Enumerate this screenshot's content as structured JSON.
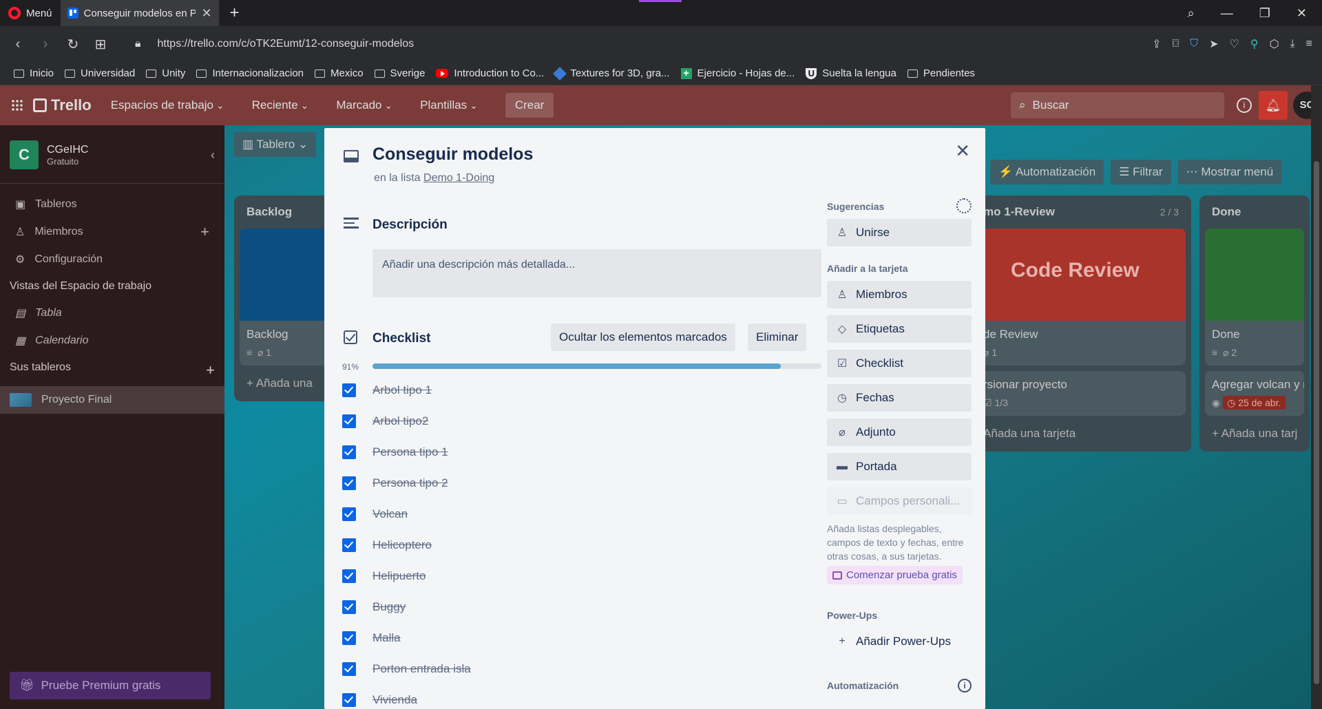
{
  "browser": {
    "menu_label": "Menú",
    "tab_title": "Conseguir modelos en Proy",
    "url": "https://trello.com/c/oTK2Eumt/12-conseguir-modelos",
    "bookmarks": [
      {
        "label": "Inicio",
        "icon": "folder-icon"
      },
      {
        "label": "Universidad",
        "icon": "folder-icon"
      },
      {
        "label": "Unity",
        "icon": "folder-icon"
      },
      {
        "label": "Internacionalizacion",
        "icon": "folder-icon"
      },
      {
        "label": "Mexico",
        "icon": "folder-icon"
      },
      {
        "label": "Sverige",
        "icon": "folder-icon"
      },
      {
        "label": "Introduction to Co...",
        "icon": "youtube-icon"
      },
      {
        "label": "Textures for 3D, gra...",
        "icon": "cube-icon"
      },
      {
        "label": "Ejercicio - Hojas de...",
        "icon": "sheets-icon"
      },
      {
        "label": "Suelta la lengua",
        "icon": "u-icon"
      },
      {
        "label": "Pendientes",
        "icon": "folder-icon"
      }
    ]
  },
  "trello": {
    "logo": "Trello",
    "nav": [
      "Espacios de trabajo",
      "Reciente",
      "Marcado",
      "Plantillas"
    ],
    "create": "Crear",
    "search_placeholder": "Buscar",
    "avatar": "SC",
    "workspace": {
      "initial": "C",
      "name": "CGeIHC",
      "plan": "Gratuito"
    },
    "sidebar_items": [
      "Tableros",
      "Miembros",
      "Configuración"
    ],
    "views_heading": "Vistas del Espacio de trabajo",
    "views": [
      "Tabla",
      "Calendario"
    ],
    "boards_heading": "Sus tableros",
    "boards": [
      "Proyecto Final"
    ],
    "premium": "Pruebe Premium gratis",
    "board_view": "Tablero",
    "automation": "Automatización",
    "filter": "Filtrar",
    "show_menu": "Mostrar menú",
    "lists": {
      "backlog": {
        "title": "Backlog",
        "card_title": "Backlog",
        "attach": "1",
        "add": "+ Añada una"
      },
      "review": {
        "title": "mo 1-Review",
        "count": "2 / 3",
        "cover_text": "Code Review",
        "card1": "de Review",
        "attach": "1",
        "card2": "rsionar proyecto",
        "check": "1/3",
        "add": "Añada una tarjeta"
      },
      "done": {
        "title": "Done",
        "card_title": "Done",
        "attach": "2",
        "card2": "Agregar volcan y m",
        "date": "25 de abr.",
        "add": "+ Añada una tarj"
      }
    }
  },
  "card": {
    "title": "Conseguir modelos",
    "in_list_prefix": "en la lista",
    "list_name": "Demo 1-Doing",
    "description_heading": "Descripción",
    "description_placeholder": "Añadir una descripción más detallada...",
    "checklist_heading": "Checklist",
    "hide_checked": "Ocultar los elementos marcados",
    "delete": "Eliminar",
    "progress_label": "91%",
    "progress_value": 0.91,
    "items": [
      "Arbol tipo 1",
      "Arbol tipo2",
      "Persona tipo 1",
      "Persona tipo 2",
      "Volcan",
      "Helicoptero",
      "Helipuerto",
      "Buggy",
      "Malla",
      "Porton entrada isla",
      "Vivienda"
    ]
  },
  "sidebar_actions": {
    "suggestions_heading": "Sugerencias",
    "join": "Unirse",
    "add_heading": "Añadir a la tarjeta",
    "members": "Miembros",
    "labels": "Etiquetas",
    "checklist": "Checklist",
    "dates": "Fechas",
    "attachment": "Adjunto",
    "cover": "Portada",
    "custom_fields": "Campos personali...",
    "custom_fields_note": "Añada listas desplegables, campos de texto y fechas, entre otras cosas, a sus tarjetas.",
    "trial": "Comenzar prueba gratis",
    "powerups_heading": "Power-Ups",
    "add_powerups": "Añadir Power-Ups",
    "automation_heading": "Automatización"
  },
  "colors": {
    "accent": "#0c66e4",
    "progress": "#5ba4cf",
    "header": "#7a3b39",
    "date_badge": "#8c2a22"
  }
}
